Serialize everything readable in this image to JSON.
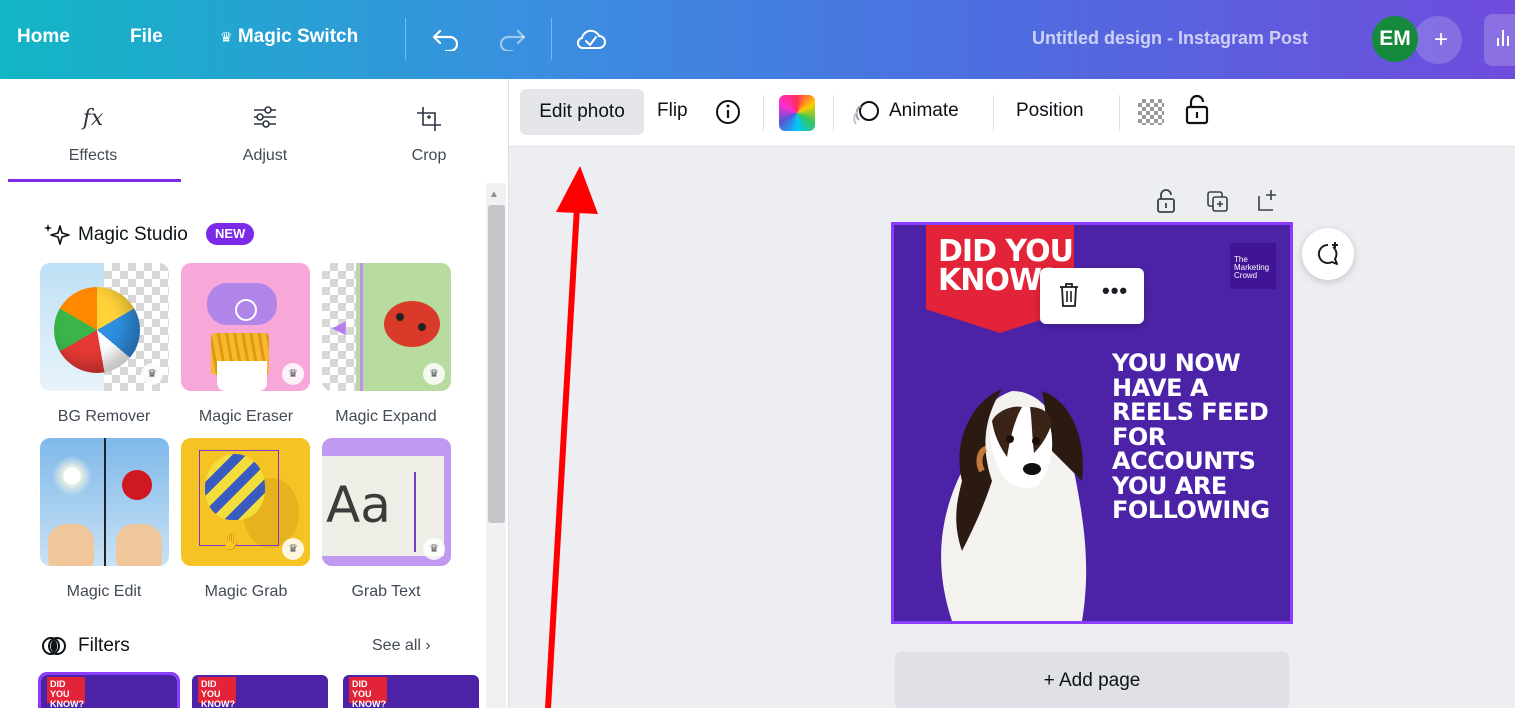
{
  "topbar": {
    "home": "Home",
    "file": "File",
    "magic_switch": "Magic Switch",
    "doc_title": "Untitled design - Instagram Post",
    "avatar_initials": "EM",
    "plus": "+"
  },
  "left_panel": {
    "tabs": [
      {
        "icon": "fx",
        "label": "Effects"
      },
      {
        "icon": "sliders-icon",
        "label": "Adjust"
      },
      {
        "icon": "crop-icon",
        "label": "Crop"
      }
    ],
    "magic_studio": {
      "title": "Magic Studio",
      "badge": "NEW"
    },
    "tools": [
      {
        "label": "BG Remover"
      },
      {
        "label": "Magic Eraser"
      },
      {
        "label": "Magic Expand"
      },
      {
        "label": "Magic Edit"
      },
      {
        "label": "Magic Grab"
      },
      {
        "label": "Grab Text"
      }
    ],
    "filters": {
      "title": "Filters",
      "see_all": "See all",
      "thumb_text": "DID YOU KNOW?"
    }
  },
  "context_toolbar": {
    "edit_photo": "Edit photo",
    "flip": "Flip",
    "animate": "Animate",
    "position": "Position"
  },
  "design": {
    "banner_text_1": "DID YOU",
    "banner_text_2": "KNOW?",
    "logo_text_1": "The",
    "logo_text_2": "Marketing",
    "logo_text_3": "Crowd",
    "body_lines": [
      "YOU NOW",
      "HAVE A",
      "REELS FEED",
      "FOR",
      "ACCOUNTS",
      "YOU ARE",
      "FOLLOWING"
    ]
  },
  "canvas": {
    "add_page": "+ Add page"
  },
  "colors": {
    "accent": "#7d2ae8",
    "design_bg": "#4c23a7",
    "banner_red": "#e32337",
    "annotation_arrow": "#ff0000"
  }
}
